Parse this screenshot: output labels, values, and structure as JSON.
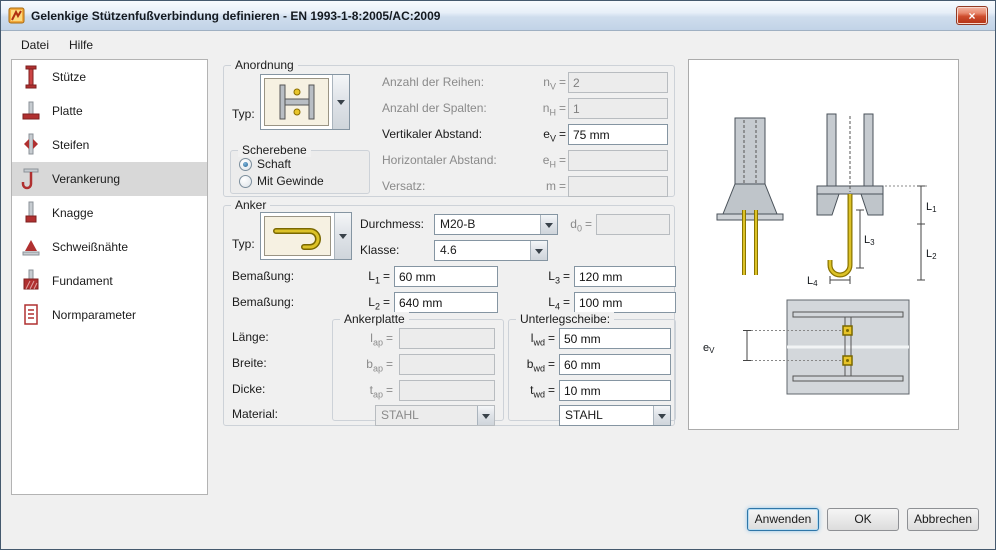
{
  "window": {
    "title": "Gelenkige Stützenfußverbindung definieren - EN 1993-1-8:2005/AC:2009",
    "close_glyph": "×"
  },
  "menu": {
    "items": [
      {
        "label": "Datei"
      },
      {
        "label": "Hilfe"
      }
    ]
  },
  "sidebar": {
    "items": [
      {
        "label": "Stütze",
        "selected": false
      },
      {
        "label": "Platte",
        "selected": false
      },
      {
        "label": "Steifen",
        "selected": false
      },
      {
        "label": "Verankerung",
        "selected": true
      },
      {
        "label": "Knagge",
        "selected": false
      },
      {
        "label": "Schweißnähte",
        "selected": false
      },
      {
        "label": "Fundament",
        "selected": false
      },
      {
        "label": "Normparameter",
        "selected": false
      }
    ]
  },
  "eq": "=",
  "anordnung": {
    "legend": "Anordnung",
    "typ_label": "Typ:",
    "fields": [
      {
        "label": "Anzahl der Reihen:",
        "sym": "n",
        "sub": "V",
        "value": "2",
        "enabled": false
      },
      {
        "label": "Anzahl der Spalten:",
        "sym": "n",
        "sub": "H",
        "value": "1",
        "enabled": false
      },
      {
        "label": "Vertikaler Abstand:",
        "sym": "e",
        "sub": "V",
        "value": "75 mm",
        "enabled": true
      },
      {
        "label": "Horizontaler Abstand:",
        "sym": "e",
        "sub": "H",
        "value": "",
        "enabled": false
      },
      {
        "label": "Versatz:",
        "sym": "m",
        "sub": "",
        "value": "",
        "enabled": false
      }
    ],
    "scherebene": {
      "legend": "Scherebene",
      "options": [
        {
          "label": "Schaft",
          "checked": true
        },
        {
          "label": "Mit Gewinde",
          "checked": false
        }
      ]
    }
  },
  "anker": {
    "legend": "Anker",
    "typ_label": "Typ:",
    "durchmess": {
      "label": "Durchmess:",
      "value": "M20-B"
    },
    "d0": {
      "sym": "d",
      "sub": "0",
      "value": ""
    },
    "klasse": {
      "label": "Klasse:",
      "value": "4.6"
    },
    "bemassung1_label": "Bemaßung:",
    "bemassung2_label": "Bemaßung:",
    "L1": {
      "sym": "L",
      "sub": "1",
      "value": "60 mm"
    },
    "L2": {
      "sym": "L",
      "sub": "2",
      "value": "640 mm"
    },
    "L3": {
      "sym": "L",
      "sub": "3",
      "value": "120 mm"
    },
    "L4": {
      "sym": "L",
      "sub": "4",
      "value": "100 mm"
    },
    "ankerplatte": {
      "legend": "Ankerplatte",
      "rows": [
        {
          "label": "Länge:",
          "sym": "l",
          "sub": "ap",
          "value": ""
        },
        {
          "label": "Breite:",
          "sym": "b",
          "sub": "ap",
          "value": ""
        },
        {
          "label": "Dicke:",
          "sym": "t",
          "sub": "ap",
          "value": ""
        }
      ],
      "material_label": "Material:",
      "material_value": "STAHL"
    },
    "unterlegscheibe": {
      "legend": "Unterlegscheibe:",
      "rows": [
        {
          "sym": "l",
          "sub": "wd",
          "value": "50 mm"
        },
        {
          "sym": "b",
          "sub": "wd",
          "value": "60 mm"
        },
        {
          "sym": "t",
          "sub": "wd",
          "value": "10 mm"
        }
      ],
      "material_value": "STAHL"
    }
  },
  "preview": {
    "dims": {
      "L1": {
        "sym": "L",
        "sub": "1"
      },
      "L2": {
        "sym": "L",
        "sub": "2"
      },
      "L3": {
        "sym": "L",
        "sub": "3"
      },
      "L4": {
        "sym": "L",
        "sub": "4"
      },
      "eV": {
        "sym": "e",
        "sub": "V"
      }
    }
  },
  "footer": {
    "buttons": [
      {
        "label": "Anwenden"
      },
      {
        "label": "OK"
      },
      {
        "label": "Abbrechen"
      }
    ]
  }
}
